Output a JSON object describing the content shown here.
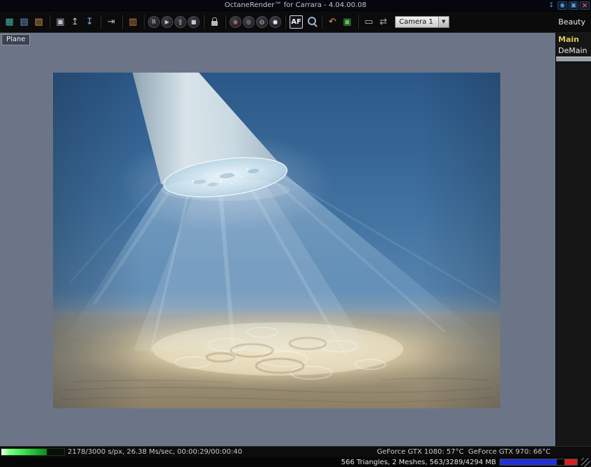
{
  "window": {
    "title": "OctaneRender™ for Carrara - 4.04.00.08",
    "controls": {
      "pin_glyph": "↧",
      "eye_glyph": "◉",
      "restore_glyph": "▣",
      "close_glyph": "×"
    }
  },
  "toolbar": {
    "camera_select": "Camera 1",
    "dropdown_arrow": "▼",
    "beauty_label": "Beauty",
    "groups": [
      [
        {
          "name": "save-render-icon",
          "glyph": "▦",
          "color": "#45b5ae"
        },
        {
          "name": "render-priority-icon",
          "glyph": "▤",
          "color": "#6f9fd8"
        },
        {
          "name": "save-image-icon",
          "glyph": "▧",
          "color": "#d89a50"
        }
      ],
      [
        {
          "name": "copy-image-icon",
          "glyph": "▣",
          "color": "#b9c2cc"
        },
        {
          "name": "copy-to-clipboard-icon",
          "glyph": "↥",
          "color": "#b9c2cc"
        },
        {
          "name": "paste-from-clipboard-icon",
          "glyph": "↧",
          "color": "#7fa8d8"
        }
      ],
      [
        {
          "name": "export-scene-icon",
          "glyph": "⇥",
          "color": "#9fb8d8"
        }
      ],
      [
        {
          "name": "material-library-icon",
          "glyph": "▥",
          "color": "#d08a45"
        }
      ],
      [
        {
          "name": "record-button",
          "glyph": "R",
          "shape": "circle",
          "color": "#c8c8cc"
        },
        {
          "name": "play-button",
          "glyph": "▶",
          "shape": "circle",
          "color": "#c8c8cc"
        },
        {
          "name": "pause-button",
          "glyph": "‖",
          "shape": "circle",
          "color": "#c8c8cc"
        },
        {
          "name": "stop-button",
          "glyph": "■",
          "shape": "circle",
          "color": "#c8c8cc"
        }
      ],
      [
        {
          "name": "lock-resolution-icon",
          "type": "lock"
        }
      ],
      [
        {
          "name": "clay-mode-icon",
          "glyph": "◉",
          "shape": "circle",
          "color": "#c87070"
        },
        {
          "name": "material-picker-icon",
          "glyph": "◎",
          "shape": "circle",
          "color": "#a8b0b8"
        },
        {
          "name": "focus-picker-icon",
          "glyph": "◍",
          "shape": "circle",
          "color": "#a8b0b8"
        },
        {
          "name": "environment-sphere-icon",
          "glyph": "●",
          "shape": "circle",
          "color": "#d8e2ea"
        }
      ],
      [
        {
          "name": "autofocus-toggle",
          "glyph": "AF",
          "active": true
        },
        {
          "name": "zoom-tool-icon",
          "type": "mag"
        }
      ],
      [
        {
          "name": "undo-icon",
          "glyph": "↶",
          "color": "#e0953f"
        },
        {
          "name": "refresh-render-icon",
          "glyph": "▣",
          "color": "#55c055"
        }
      ],
      [
        {
          "name": "picture-viewer-icon",
          "glyph": "▭",
          "color": "#b8c0c8"
        },
        {
          "name": "reset-view-icon",
          "glyph": "⇄",
          "color": "#98a8b8"
        }
      ]
    ]
  },
  "viewport": {
    "object_label": "Plane"
  },
  "sidebar": {
    "tabs": [
      {
        "label": "Main"
      },
      {
        "label": "DeMain"
      }
    ]
  },
  "status": {
    "progress_text": "2178/3000 s/px, 26.38 Ms/sec, 00:00:29/00:00:40",
    "progress_percent": 72.6,
    "gpu_text": "GeForce GTX 1080: 57°C  GeForce GTX 970: 66°C",
    "mesh_text": "566 Triangles, 2 Meshes, 563/3289/4294 MB",
    "vram_blue_pct": 74,
    "vram_red_pct": 16
  },
  "colors": {
    "accent-yellow": "#d9c85a",
    "pass-main-bar": "#4a1111",
    "pass-demain-bar": "#9aa0a8",
    "progress-green": "#35d948",
    "vram-blue": "#2230d8",
    "vram-red": "#d62020",
    "close-red": "#ff5040",
    "title-icon-blue": "#5aa0e8"
  }
}
